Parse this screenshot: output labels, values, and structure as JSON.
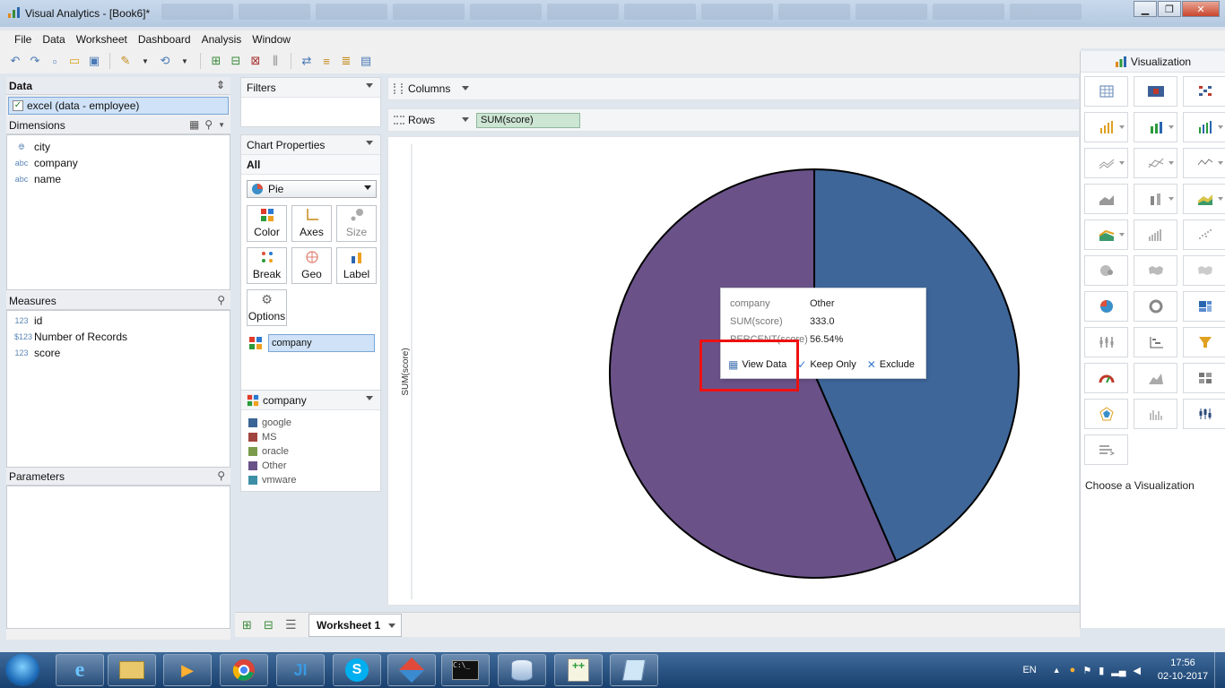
{
  "window": {
    "title": "Visual Analytics - [Book6]*"
  },
  "menu": [
    "File",
    "Data",
    "Worksheet",
    "Dashboard",
    "Analysis",
    "Window"
  ],
  "data_panel": {
    "header": "Data",
    "datasource": "excel (data - employee)",
    "dimensions_header": "Dimensions",
    "dimensions": [
      {
        "type": "geo",
        "name": "city"
      },
      {
        "type": "abc",
        "name": "company"
      },
      {
        "type": "abc",
        "name": "name"
      }
    ],
    "measures_header": "Measures",
    "measures": [
      {
        "type": "123",
        "name": "id"
      },
      {
        "type": "$123",
        "name": "Number of Records"
      },
      {
        "type": "123",
        "name": "score"
      }
    ],
    "parameters_header": "Parameters"
  },
  "filters": {
    "header": "Filters"
  },
  "chart_properties": {
    "header": "Chart Properties",
    "scope": "All",
    "chart_type": "Pie",
    "buttons": [
      "Color",
      "Axes",
      "Size",
      "Break",
      "Geo",
      "Label",
      "Options"
    ],
    "color_field": "company"
  },
  "legend": {
    "header": "company",
    "items": [
      {
        "label": "google",
        "color": "#3b6496"
      },
      {
        "label": "MS",
        "color": "#a2443e"
      },
      {
        "label": "oracle",
        "color": "#7b9b4a"
      },
      {
        "label": "Other",
        "color": "#6a5289"
      },
      {
        "label": "vmware",
        "color": "#3d8fa6"
      }
    ]
  },
  "shelves": {
    "columns_label": "Columns",
    "rows_label": "Rows",
    "rows_pill": "SUM(score)"
  },
  "chart_data": {
    "type": "pie",
    "ylabel": "SUM(score)",
    "slices": [
      {
        "label": "google",
        "percent": 43.46,
        "color": "#3e6699"
      },
      {
        "label": "Other",
        "value": 333.0,
        "percent": 56.54,
        "color": "#6a5289"
      }
    ]
  },
  "tooltip": {
    "rows": [
      {
        "key": "company",
        "value": "Other"
      },
      {
        "key": "SUM(score)",
        "value": "333.0"
      },
      {
        "key": "PERCENT(score)",
        "value": "56.54%"
      }
    ],
    "actions": {
      "view_data": "View Data",
      "keep_only": "Keep Only",
      "exclude": "Exclude"
    }
  },
  "viz_panel": {
    "header": "Visualization",
    "footer": "Choose a Visualization"
  },
  "sheet_tab": "Worksheet 1",
  "taskbar": {
    "language": "EN",
    "time": "17:56",
    "date": "02-10-2017"
  }
}
